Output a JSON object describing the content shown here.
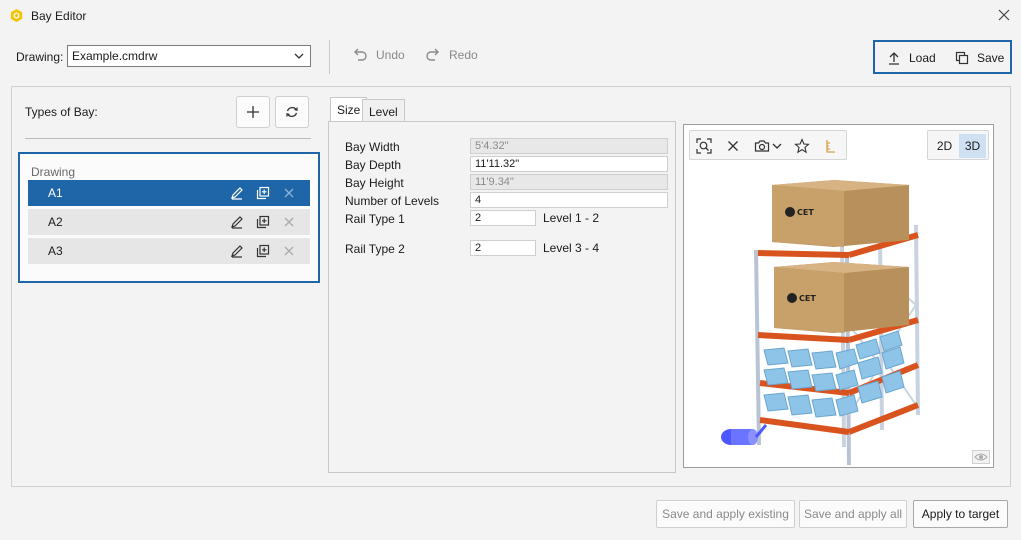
{
  "window": {
    "title": "Bay Editor",
    "icon": "hexagon-logo-icon"
  },
  "toolbar": {
    "drawing_label": "Drawing:",
    "drawing_value": "Example.cmdrw",
    "undo_label": "Undo",
    "redo_label": "Redo",
    "load_label": "Load",
    "save_label": "Save"
  },
  "left_panel": {
    "types_label": "Types of Bay:",
    "group_label": "Drawing",
    "bays": [
      {
        "name": "A1",
        "selected": true
      },
      {
        "name": "A2",
        "selected": false
      },
      {
        "name": "A3",
        "selected": false
      }
    ]
  },
  "tabs": [
    {
      "label": "Size",
      "active": true
    },
    {
      "label": "Level",
      "active": false
    }
  ],
  "size": {
    "bay_width_label": "Bay Width",
    "bay_width_value": "5'4.32\"",
    "bay_depth_label": "Bay Depth",
    "bay_depth_value": "11'11.32\"",
    "bay_height_label": "Bay Height",
    "bay_height_value": "11'9.34\"",
    "levels_label": "Number of Levels",
    "levels_value": "4",
    "rail1_label": "Rail Type 1",
    "rail1_value": "2",
    "rail1_range": "Level 1 - 2",
    "rail2_label": "Rail Type 2",
    "rail2_value": "2",
    "rail2_range": "Level 3 - 4"
  },
  "viewport": {
    "btn_2d": "2D",
    "btn_3d": "3D",
    "mode": "3D",
    "box_logo": "CET"
  },
  "footer": {
    "save_apply_existing": "Save and apply existing",
    "save_apply_all": "Save and apply all",
    "apply_to_target": "Apply to target"
  },
  "colors": {
    "accent": "#1f66a8",
    "rack_beam": "#d9531e",
    "rack_upright": "#c9d3e0",
    "bin": "#8ec4e8",
    "box": "#c8a06a"
  }
}
